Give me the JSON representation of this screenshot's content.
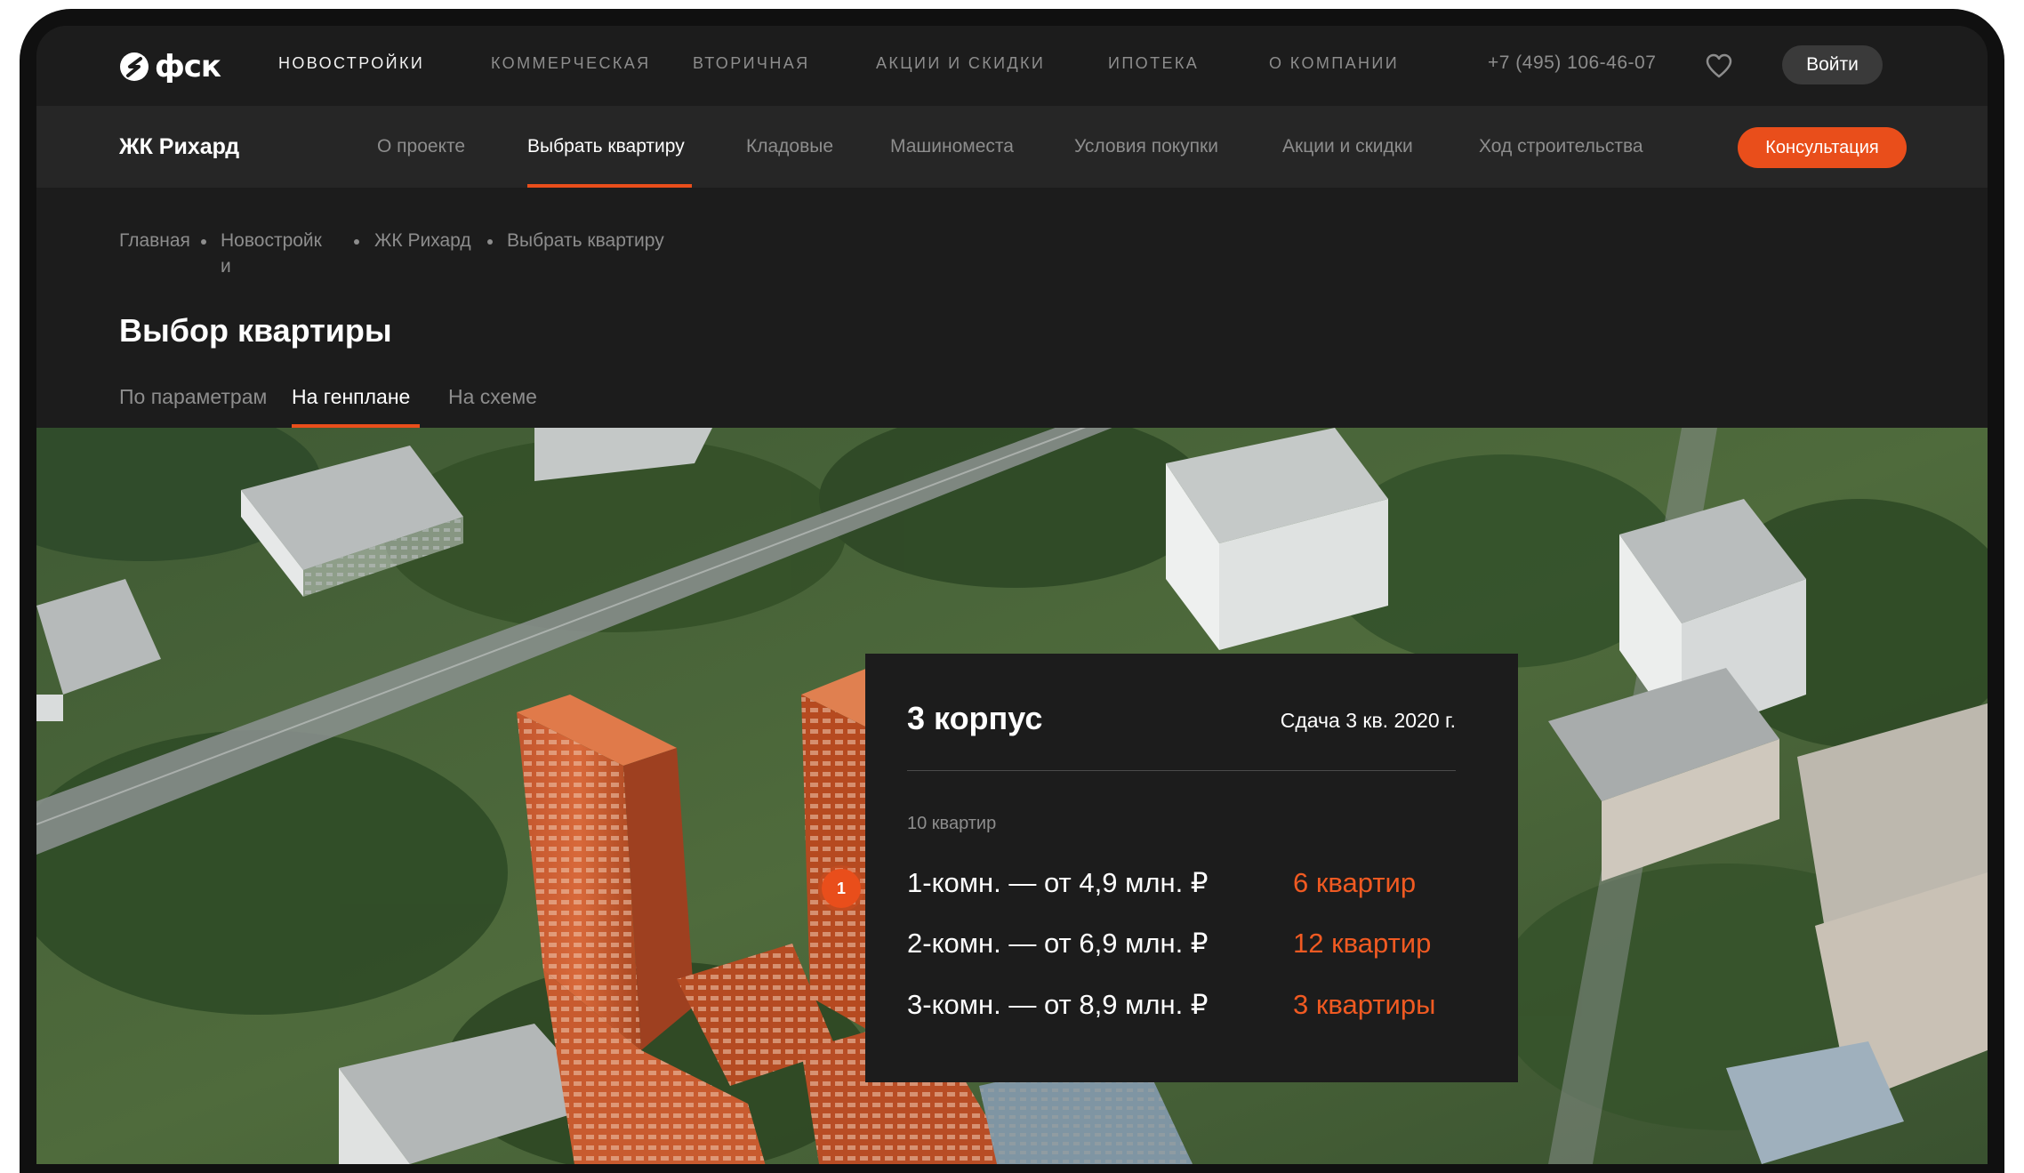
{
  "brand": {
    "logo_text": "фск",
    "accent": "#e94e1b"
  },
  "topnav": {
    "items": [
      "Новостройки",
      "Коммерческая",
      "Вторичная",
      "Акции и скидки",
      "Ипотека",
      "О компании"
    ],
    "phone": "+7 (495) 106-46-07",
    "login": "Войти"
  },
  "subnav": {
    "project": "ЖК Рихард",
    "items": [
      "О проекте",
      "Выбрать квартиру",
      "Кладовые",
      "Машиноместа",
      "Условия покупки",
      "Акции и скидки",
      "Ход строительства"
    ],
    "active": "Выбрать квартиру",
    "consult": "Консультация"
  },
  "breadcrumb": {
    "home": "Главная",
    "new_line1": "Новостройк",
    "new_line2": "и",
    "project": "ЖК Рихард",
    "current": "Выбрать квартиру"
  },
  "page": {
    "title": "Выбор квартиры",
    "tabs": [
      "По параметрам",
      "На генплане",
      "На схеме"
    ],
    "active_tab": "На генплане"
  },
  "map": {
    "pin_label": "1",
    "card": {
      "title": "3 корпус",
      "date": "Сдача 3 кв. 2020 г.",
      "count": "10 квартир",
      "rows": [
        {
          "label": "1-комн. — от 4,9 млн. ₽",
          "value": "6 квартир"
        },
        {
          "label": "2-комн. — от 6,9 млн. ₽",
          "value": "12 квартир"
        },
        {
          "label": "3-комн. — от 8,9 млн. ₽",
          "value": "3 квартиры"
        }
      ]
    }
  }
}
